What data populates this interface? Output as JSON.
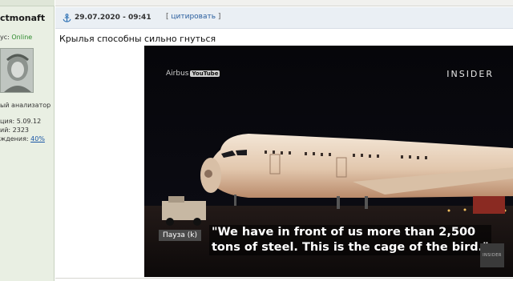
{
  "user": {
    "username": "ctmonaft",
    "status_prefix": "ус: ",
    "status_value": "Online",
    "rank": "ый анализатор",
    "stats": {
      "registered": "ция: 5.09.12",
      "posts": "ий: 2323",
      "reputation_prefix": "ждения: ",
      "reputation_value": "40%"
    }
  },
  "post": {
    "date": "29.07.2020 - 09:41",
    "quote_open": "[ ",
    "quote_label": "цитировать",
    "quote_close": " ]",
    "text": "Крылья способны сильно гнуться"
  },
  "video": {
    "source_label": "Airbus",
    "source_badge": "YouTube",
    "brand": "INSIDER",
    "pause_label": "Пауза (k)",
    "subtitle_line1": "\"We have in front of us more than 2,500",
    "subtitle_line2": "tons of steel. This is the cage of the bird.\"",
    "corner_logo": "INSIDER"
  },
  "colors": {
    "user_col_bg": "#e9efe3",
    "header_bg": "#eaeff4",
    "online": "#2d8a2d",
    "link": "#1b57a6"
  }
}
